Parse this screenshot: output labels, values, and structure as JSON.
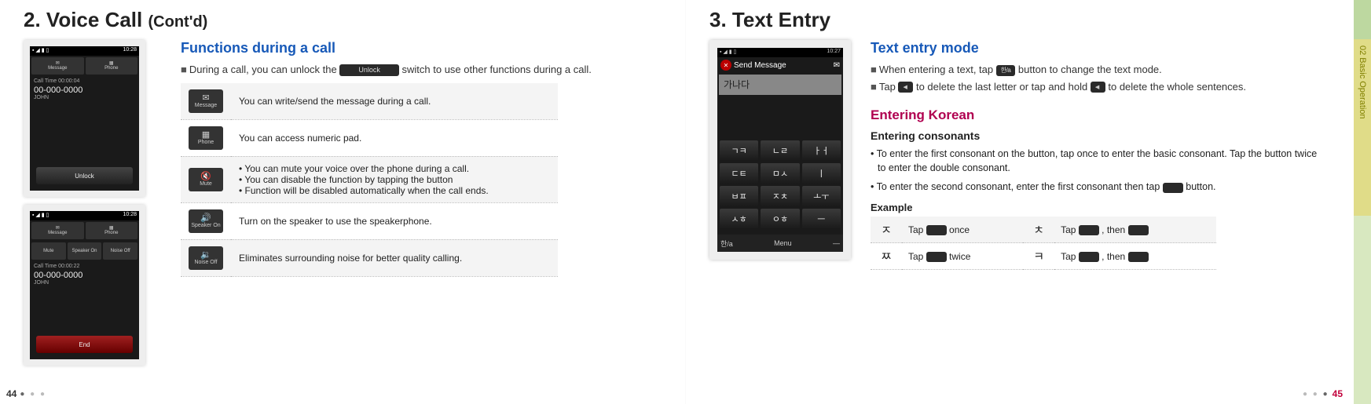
{
  "left": {
    "heading_main": "2. Voice Call",
    "heading_cont": "(Cont'd)",
    "section_title": "Functions during a call",
    "note_prefix": "During a call, you can unlock the",
    "unlock_btn": "Unlock",
    "note_suffix": "switch to use other functions during a call.",
    "phone1": {
      "time": "10:28",
      "tab1": "Message",
      "tab2": "Phone",
      "calltime": "Call Time  00:00:04",
      "number": "00-000-0000",
      "name": "JOHN",
      "button": "Unlock"
    },
    "phone2": {
      "time": "10:28",
      "tab1": "Message",
      "tab2": "Phone",
      "tab3": "Mute",
      "tab4": "Speaker On",
      "tab5": "Noise Off",
      "calltime": "Call Time  00:00:22",
      "number": "00-000-0000",
      "name": "JOHN",
      "button": "End"
    },
    "rows": [
      {
        "icon_label": "Message",
        "glyph": "✉",
        "text": "You can write/send the message during a call."
      },
      {
        "icon_label": "Phone",
        "glyph": "▦",
        "text": "You can access numeric pad."
      },
      {
        "icon_label": "Mute",
        "glyph": "🔇",
        "bullets": [
          "You can mute your voice over the phone during a call.",
          "You can disable the function by tapping the button",
          "Function will be disabled automatically when the call ends."
        ]
      },
      {
        "icon_label": "Speaker On",
        "glyph": "🔊",
        "text": "Turn on the speaker to use the speakerphone."
      },
      {
        "icon_label": "Noise Off",
        "glyph": "🔉",
        "text": "Eliminates surrounding noise for better quality calling."
      }
    ],
    "page_num": "44"
  },
  "right": {
    "heading_main": "3. Text Entry",
    "section_title": "Text entry mode",
    "note1_prefix": "When entering a text, tap",
    "note1_btn": "한/a",
    "note1_suffix": "button to change the text mode.",
    "note2_prefix": "Tap",
    "note2_mid": "to delete the last letter or tap and hold",
    "note2_suffix": "to delete the whole sentences.",
    "sub_title": "Entering Korean",
    "sub_sub": "Entering consonants",
    "bullets": [
      "To enter the first consonant on the button, tap once to enter the basic consonant. Tap the button twice to enter the double consonant.",
      "To enter the second consonant, enter the first consonant then tap"
    ],
    "bullet2_suffix": "button.",
    "example_label": "Example",
    "ex": {
      "c1": "ㅈ",
      "t1a": "Tap",
      "t1b": "once",
      "c2": "ㅊ",
      "t2a": "Tap",
      "t2b": ", then",
      "c3": "ㅉ",
      "t3a": "Tap",
      "t3b": "twice",
      "c4": "ㅋ",
      "t4a": "Tap",
      "t4b": ", then"
    },
    "phone": {
      "time": "10:27",
      "title": "Send Message",
      "textarea": "가나다",
      "keys": [
        "ㄱㅋ",
        "ㄴㄹ",
        "ㅏㅓ",
        "ㄷㅌ",
        "ㅁㅅ",
        "ㅣ",
        "ㅂㅍ",
        "ㅈㅊ",
        "ㅗㅜ",
        "ㅅㅎ",
        "ㅇㅎ",
        "ㅡ"
      ],
      "bot_left": "한/a",
      "bot_mid": "Menu",
      "bot_right": "—"
    },
    "side_tab": "02 Basic Operation",
    "page_num": "45"
  }
}
